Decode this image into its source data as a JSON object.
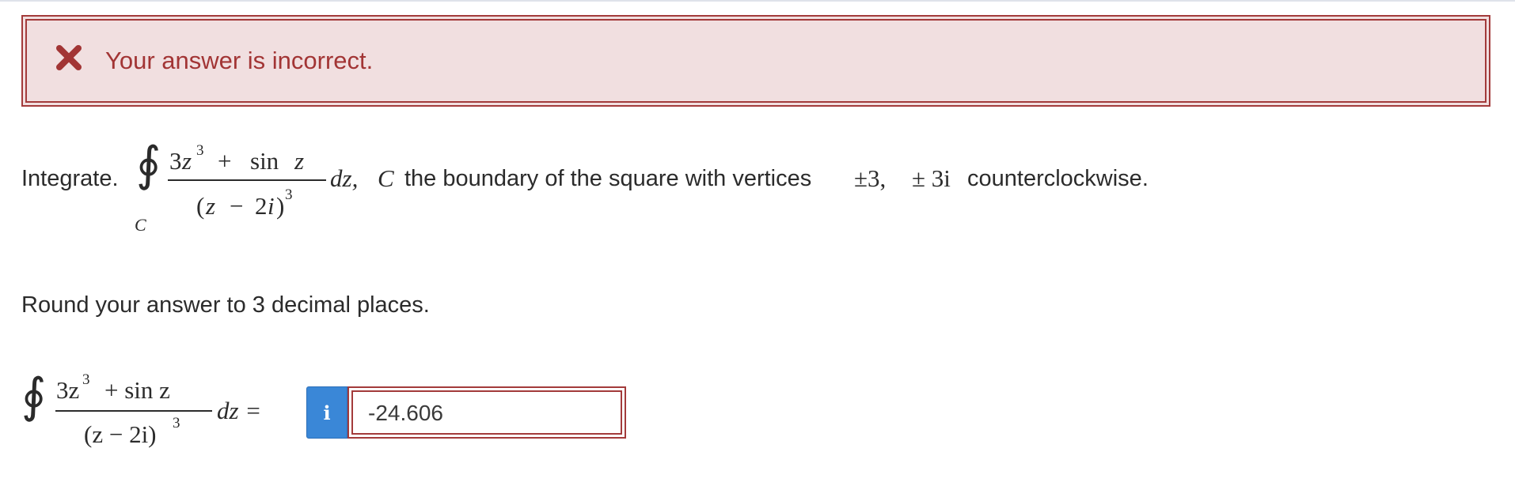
{
  "feedback": {
    "icon": "x-mark-icon",
    "message": "Your answer is incorrect.",
    "color": "#a23535",
    "background": "#f1dfe0"
  },
  "problem": {
    "lead": "Integrate.",
    "integral_symbol": "∮",
    "contour_sub": "C",
    "numerator": {
      "coef": "3",
      "var": "z",
      "exp": "3",
      "plus": "+",
      "func": "sin",
      "arg": "z"
    },
    "denominator": {
      "open": "(",
      "var": "z",
      "minus": "−",
      "num": "2",
      "i": "i",
      "close": ")",
      "exp": "3"
    },
    "differential": "dz,",
    "curve": "C",
    "description": "the boundary of the square with vertices",
    "vertices_a": "±3,",
    "vertices_b": "± 3i",
    "direction": "counterclockwise."
  },
  "instruction": "Round your answer to 3 decimal places.",
  "answer": {
    "integral_symbol": "∮",
    "numerator": "3z",
    "numerator_exp": "3",
    "numerator_rest": "+ sin z",
    "denominator": "(z − 2i)",
    "denominator_exp": "3",
    "differential": "dz =",
    "info_icon": "info-icon",
    "info_label": "i",
    "value": "-24.606"
  },
  "colors": {
    "error": "#a33b3b",
    "info_button": "#3a87d7",
    "text": "#2b2b2b"
  }
}
